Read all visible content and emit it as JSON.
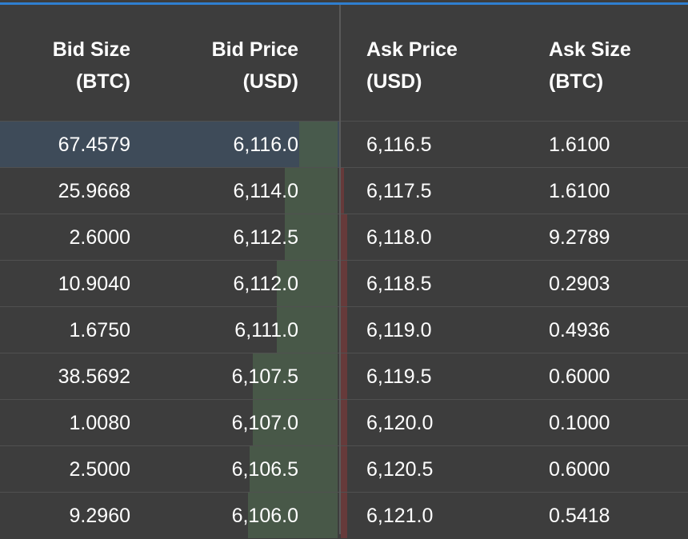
{
  "colors": {
    "background": "#3d3d3d",
    "accent": "#2f7fd0",
    "bid_depth": "#4a5d4a",
    "ask_depth": "#6a3a3a",
    "highlight_row": "#3e4b59"
  },
  "headers": {
    "bid_size": [
      "Bid Size",
      "(BTC)"
    ],
    "bid_price": [
      "Bid Price",
      "(USD)"
    ],
    "ask_price": [
      "Ask Price",
      "(USD)"
    ],
    "ask_size": [
      "Ask Size",
      "(BTC)"
    ]
  },
  "rows": [
    {
      "bid_size": "67.4579",
      "bid_price": "6,116.0",
      "ask_price": "6,116.5",
      "ask_size": "1.6100",
      "bid_depth": 0.24,
      "ask_depth": 0.0,
      "highlight": true
    },
    {
      "bid_size": "25.9668",
      "bid_price": "6,114.0",
      "ask_price": "6,117.5",
      "ask_size": "1.6100",
      "bid_depth": 0.33,
      "ask_depth": 0.01
    },
    {
      "bid_size": "2.6000",
      "bid_price": "6,112.5",
      "ask_price": "6,118.0",
      "ask_size": "9.2789",
      "bid_depth": 0.33,
      "ask_depth": 0.02
    },
    {
      "bid_size": "10.9040",
      "bid_price": "6,112.0",
      "ask_price": "6,118.5",
      "ask_size": "0.2903",
      "bid_depth": 0.38,
      "ask_depth": 0.02
    },
    {
      "bid_size": "1.6750",
      "bid_price": "6,111.0",
      "ask_price": "6,119.0",
      "ask_size": "0.4936",
      "bid_depth": 0.38,
      "ask_depth": 0.02
    },
    {
      "bid_size": "38.5692",
      "bid_price": "6,107.5",
      "ask_price": "6,119.5",
      "ask_size": "0.6000",
      "bid_depth": 0.53,
      "ask_depth": 0.02
    },
    {
      "bid_size": "1.0080",
      "bid_price": "6,107.0",
      "ask_price": "6,120.0",
      "ask_size": "0.1000",
      "bid_depth": 0.53,
      "ask_depth": 0.02
    },
    {
      "bid_size": "2.5000",
      "bid_price": "6,106.5",
      "ask_price": "6,120.5",
      "ask_size": "0.6000",
      "bid_depth": 0.55,
      "ask_depth": 0.02
    },
    {
      "bid_size": "9.2960",
      "bid_price": "6,106.0",
      "ask_price": "6,121.0",
      "ask_size": "0.5418",
      "bid_depth": 0.56,
      "ask_depth": 0.02
    }
  ]
}
